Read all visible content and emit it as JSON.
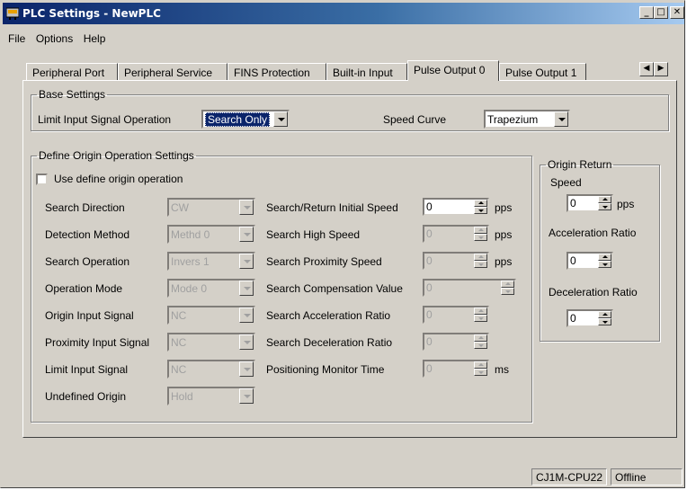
{
  "window": {
    "title": "PLC Settings - NewPLC"
  },
  "menu": [
    "File",
    "Options",
    "Help"
  ],
  "tabs": [
    "Peripheral Port",
    "Peripheral Service",
    "FINS Protection",
    "Built-in Input",
    "Pulse Output 0",
    "Pulse Output 1"
  ],
  "active_tab": "Pulse Output 0",
  "base_settings": {
    "legend": "Base Settings",
    "limit_input_label": "Limit Input Signal Operation",
    "limit_input_value": "Search Only",
    "speed_curve_label": "Speed Curve",
    "speed_curve_value": "Trapezium"
  },
  "define_origin": {
    "legend": "Define Origin Operation Settings",
    "use_define_label": "Use define origin operation",
    "left_rows": [
      {
        "label": "Search Direction",
        "value": "CW"
      },
      {
        "label": "Detection Method",
        "value": "Methd 0"
      },
      {
        "label": "Search Operation",
        "value": "Invers 1"
      },
      {
        "label": "Operation Mode",
        "value": "Mode 0"
      },
      {
        "label": "Origin Input Signal",
        "value": "NC"
      },
      {
        "label": "Proximity Input Signal",
        "value": "NC"
      },
      {
        "label": "Limit Input Signal",
        "value": "NC"
      },
      {
        "label": "Undefined Origin",
        "value": "Hold"
      }
    ],
    "right_rows": [
      {
        "label": "Search/Return Initial Speed",
        "value": "0",
        "unit": "pps"
      },
      {
        "label": "Search High Speed",
        "value": "0",
        "unit": "pps"
      },
      {
        "label": "Search Proximity Speed",
        "value": "0",
        "unit": "pps"
      },
      {
        "label": "Search Compensation Value",
        "value": "0",
        "unit": ""
      },
      {
        "label": "Search Acceleration Ratio",
        "value": "0",
        "unit": ""
      },
      {
        "label": "Search Deceleration Ratio",
        "value": "0",
        "unit": ""
      },
      {
        "label": "Positioning Monitor Time",
        "value": "0",
        "unit": "ms"
      }
    ]
  },
  "origin_return": {
    "legend": "Origin Return",
    "speed_label": "Speed",
    "speed_value": "0",
    "speed_unit": "pps",
    "accel_label": "Acceleration Ratio",
    "accel_value": "0",
    "decel_label": "Deceleration Ratio",
    "decel_value": "0"
  },
  "status": {
    "model": "CJ1M-CPU22",
    "mode": "Offline"
  }
}
